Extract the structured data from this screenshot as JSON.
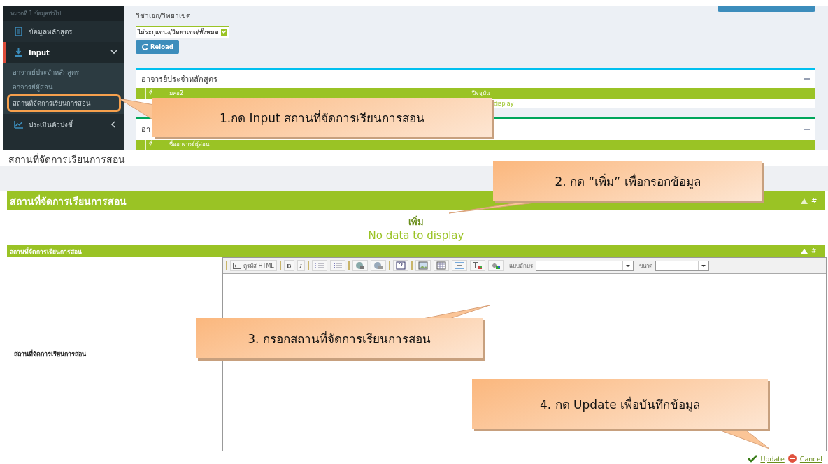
{
  "top_screen": {
    "sidebar": {
      "section_label": "หมวดที่ 1 ข้อมูลทั่วไป",
      "items": [
        {
          "label": "ข้อมูลหลักสูตร",
          "kind": "link",
          "selected": false
        },
        {
          "label": "Input",
          "kind": "group",
          "selected": true,
          "expanded": true,
          "children": [
            {
              "label": "อาจารย์ประจำหลักสูตร",
              "highlighted": false
            },
            {
              "label": "อาจารย์ผู้สอน",
              "highlighted": false
            },
            {
              "label": "สถานที่จัดการเรียนการสอน",
              "highlighted": true
            }
          ]
        },
        {
          "label": "ประเมินตัวบ่งชี้",
          "kind": "group",
          "selected": false,
          "expanded": false
        }
      ]
    },
    "main": {
      "subtitle": "วิชาเอก/วิทยาเขต",
      "filter": {
        "value": "ไม่ระบุแขนง/วิทยาเขต/ทั้งหมด"
      },
      "reload_button": "Reload",
      "panels": [
        {
          "title": "อาจารย์ประจำหลักสูตร",
          "columns": [
            "ที่",
            "มคอ2",
            "ปีจจุบัน"
          ],
          "empty_text": "display"
        },
        {
          "title": "อา",
          "columns": [
            "ที่",
            "ชื่ออาจารย์ผู้สอน"
          ]
        }
      ]
    }
  },
  "list_screen": {
    "title": "สถานที่จัดการเรียนการสอน",
    "grid": {
      "header": "สถานที่จัดการเรียนการสอน",
      "hash": "#",
      "add_link": "เพิ่ม",
      "empty_text": "No data to display"
    }
  },
  "edit_screen": {
    "header": {
      "title": "สถานที่จัดการเรียนการสอน",
      "hash": "#"
    },
    "field_label": "สถานที่จัดการเรียนการสอน",
    "toolbar": {
      "html_button": "ดูรหัส HTML",
      "bold": "B",
      "italic": "I",
      "font_label": "แบบอักษร",
      "size_label": "ขนาด"
    },
    "actions": {
      "update": "Update",
      "cancel": "Cancel"
    }
  },
  "callouts": [
    {
      "text": "1.กด Input สถานที่จัดการเรียนการสอน"
    },
    {
      "text": "2. กด “เพิ่ม” เพื่อกรอกข้อมูล"
    },
    {
      "text": "3. กรอกสถานที่จัดการเรียนการสอน"
    },
    {
      "text": "4. กด Update เพื่อบันทึกข้อมูล"
    }
  ]
}
